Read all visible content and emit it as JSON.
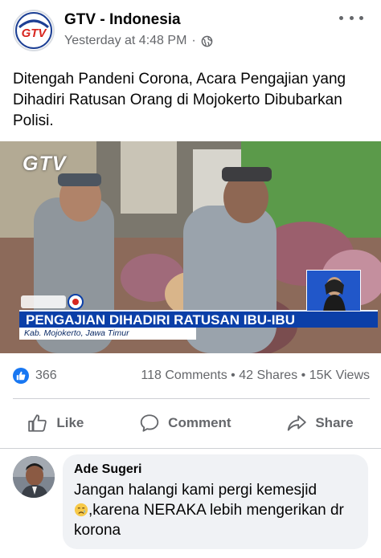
{
  "post": {
    "page_name": "GTV - Indonesia",
    "avatar_text": "GTV",
    "timestamp": "Yesterday at 4:48 PM",
    "separator": "·",
    "audience_icon": "globe-icon",
    "text": "Ditengah Pandeni Corona, Acara Pengajian yang Dihadiri Ratusan Orang di Mojokerto Dibubarkan Polisi."
  },
  "video": {
    "watermark": "GTV",
    "headline": "PENGAJIAN DIHADIRI RATUSAN IBU-IBU",
    "location": "Kab. Mojokerto, Jawa Timur",
    "colors": {
      "headline_bg": "#0b3fa8",
      "sign_box_bg": "#2157c9"
    }
  },
  "stats": {
    "likes": "366",
    "comments": "118 Comments",
    "shares": "42 Shares",
    "views": "15K Views",
    "dot": "•"
  },
  "actions": {
    "like": "Like",
    "comment": "Comment",
    "share": "Share"
  },
  "comment": {
    "author": "Ade Sugeri",
    "line1": "Jangan halangi kami pergi kemesjid",
    "emoji": "crying-face-emoji",
    "line2": ",karena NERAKA lebih mengerikan dr korona"
  },
  "colors": {
    "accent": "#1877f2",
    "secondary_text": "#65676b",
    "bubble": "#f0f2f5"
  }
}
